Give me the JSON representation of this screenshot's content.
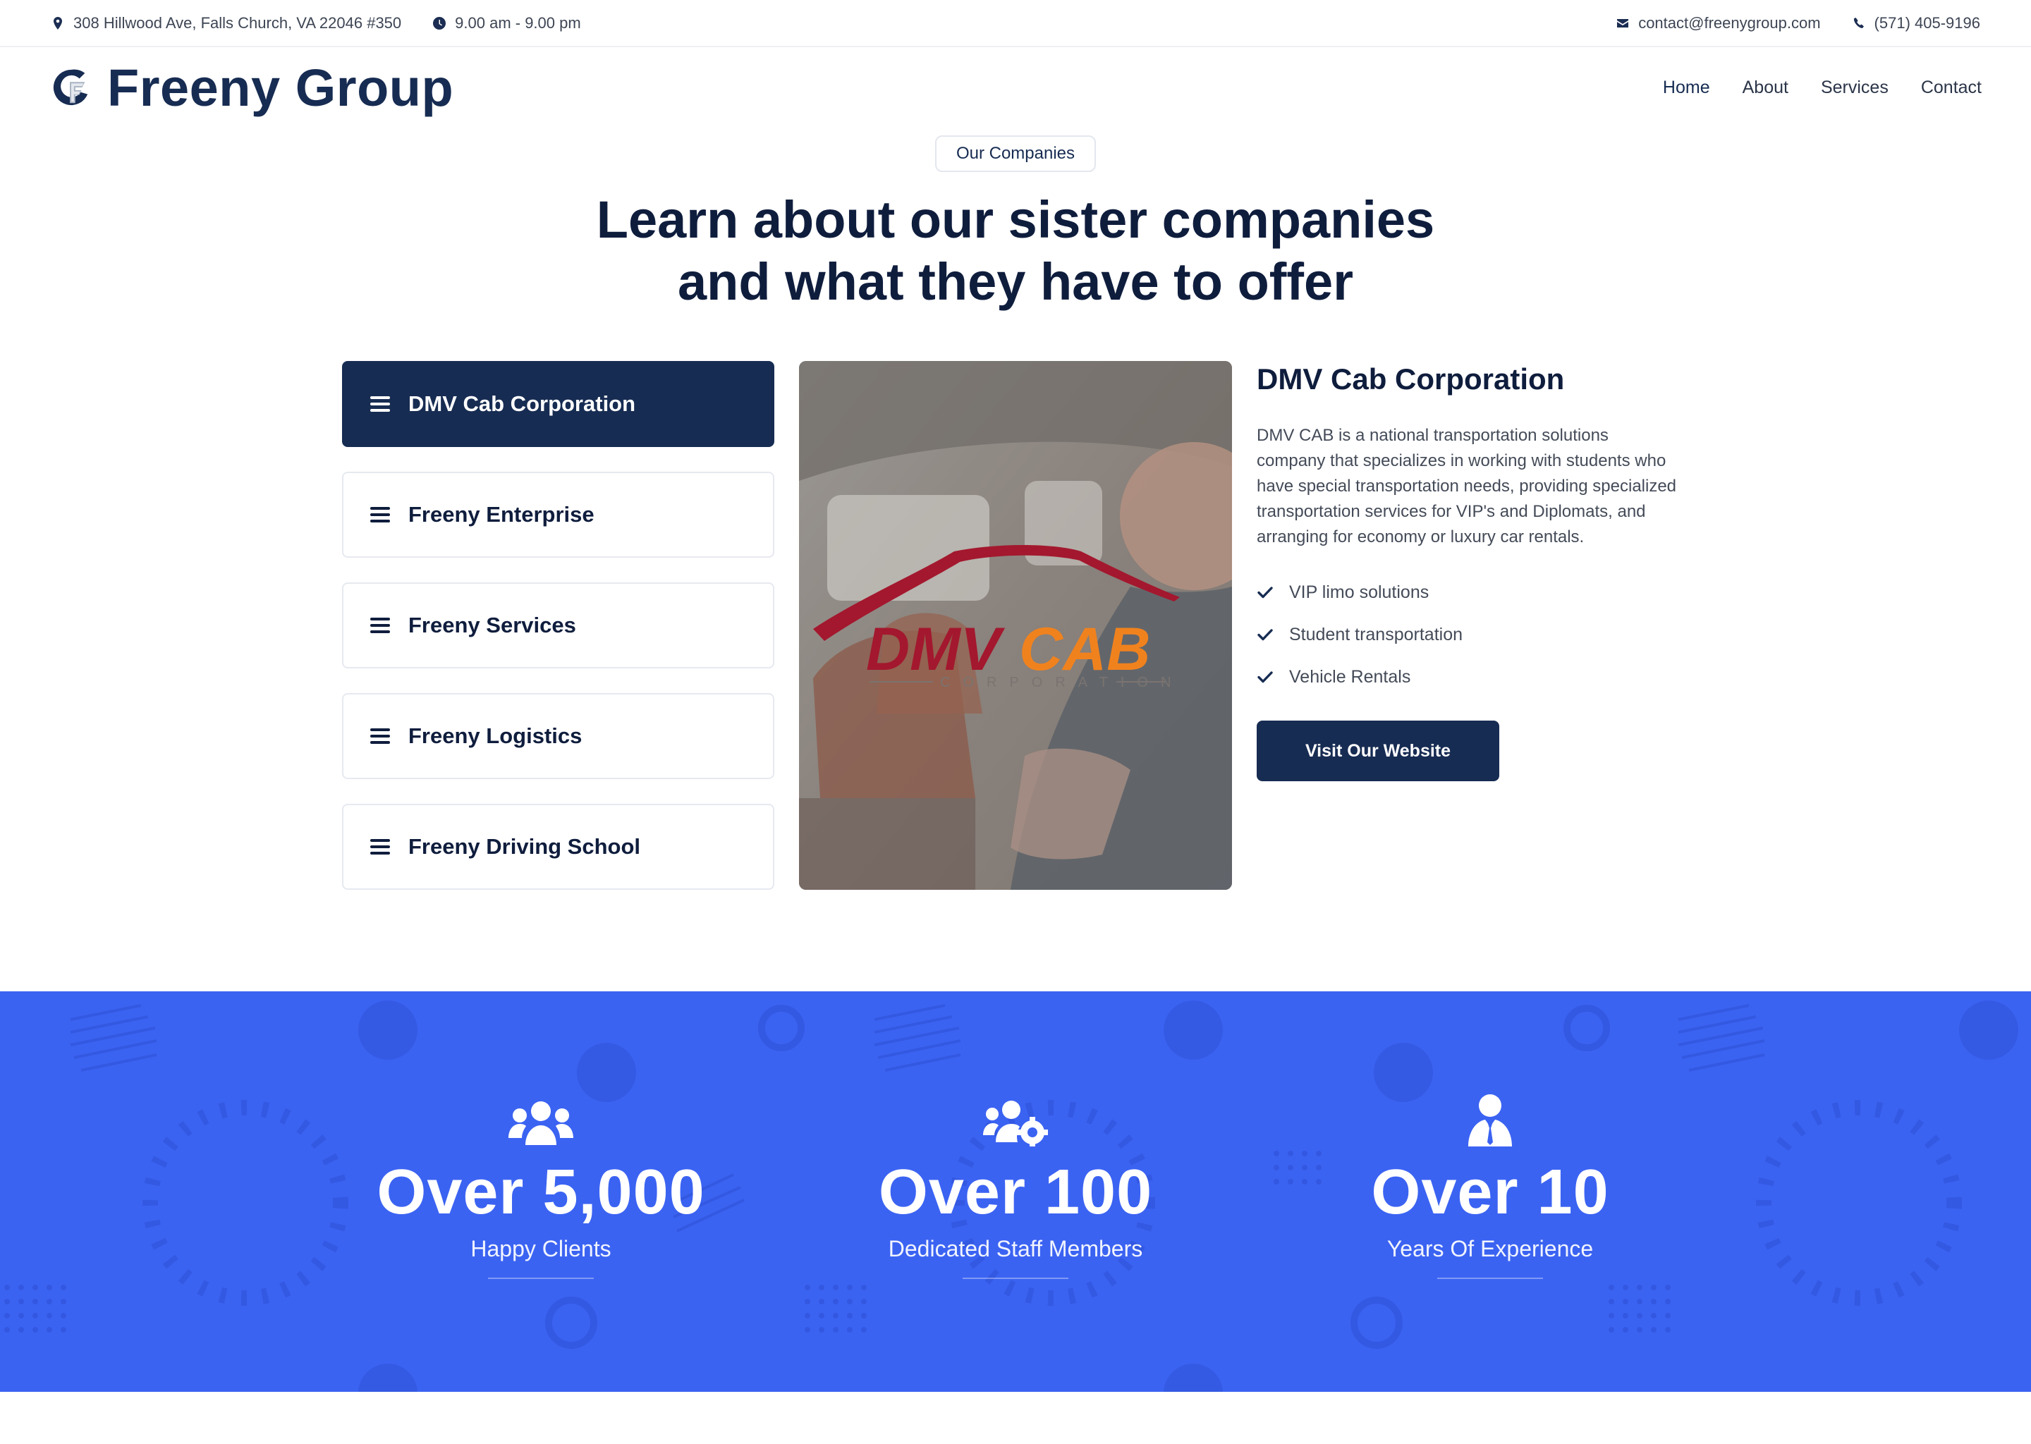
{
  "topbar": {
    "address": "308 Hillwood Ave, Falls Church, VA 22046 #350",
    "hours": "9.00 am - 9.00 pm",
    "email": "contact@freenygroup.com",
    "phone": "(571) 405-9196"
  },
  "brand": {
    "name": "Freeny Group"
  },
  "nav": {
    "items": [
      "Home",
      "About",
      "Services",
      "Contact"
    ],
    "active": "Home"
  },
  "section": {
    "tag": "Our Companies",
    "title_line1": "Learn about our sister companies",
    "title_line2": "and what they have to offer"
  },
  "tabs": [
    {
      "label": "DMV Cab Corporation",
      "active": true
    },
    {
      "label": "Freeny Enterprise",
      "active": false
    },
    {
      "label": "Freeny Services",
      "active": false
    },
    {
      "label": "Freeny Logistics",
      "active": false
    },
    {
      "label": "Freeny Driving School",
      "active": false
    }
  ],
  "image": {
    "logo_text_1": "DMV",
    "logo_text_2": "CAB",
    "logo_sub": "CORPORATION"
  },
  "detail": {
    "title": "DMV Cab Corporation",
    "description": "DMV CAB is a national transportation solutions company that specializes in working with students who have special transportation needs, providing specialized transportation services for VIP's and Diplomats, and arranging for economy or luxury car rentals.",
    "features": [
      "VIP limo solutions",
      "Student transportation",
      "Vehicle Rentals"
    ],
    "button": "Visit Our Website"
  },
  "stats": [
    {
      "icon": "users-icon",
      "value": "Over 5,000",
      "label": "Happy Clients"
    },
    {
      "icon": "users-cog-icon",
      "value": "Over 100",
      "label": "Dedicated Staff Members"
    },
    {
      "icon": "user-tie-icon",
      "value": "Over 10",
      "label": "Years Of Experience"
    }
  ],
  "colors": {
    "navy": "#172c52",
    "stats_bg": "#3b63f2",
    "logo_red": "#a3182e",
    "logo_orange": "#f0821e"
  }
}
